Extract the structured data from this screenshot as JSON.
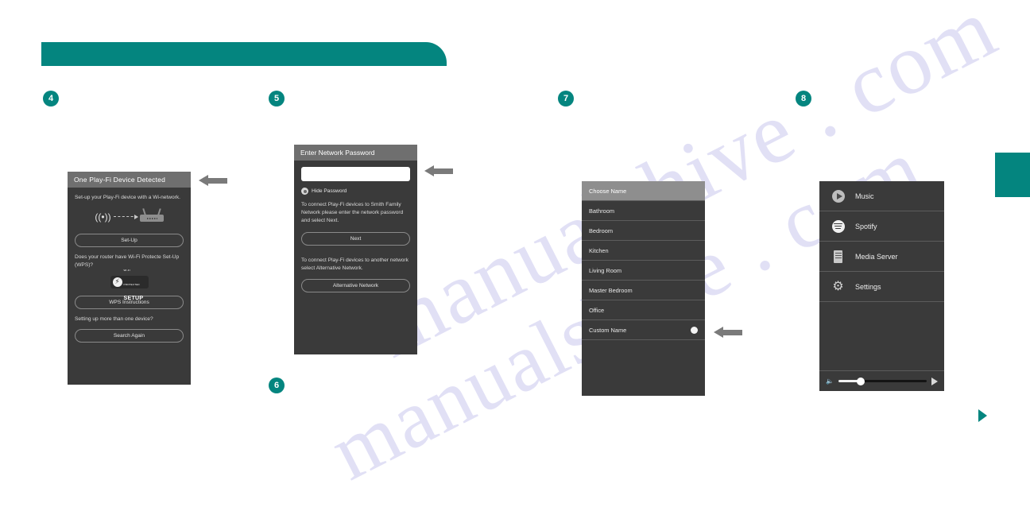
{
  "page": {
    "watermark_line1": "manualshive . com",
    "watermark_line2": "manualshive . com"
  },
  "header": {
    "bar_color": "#04857f",
    "side_tab_color": "#04857f",
    "corner_marker": "play-triangle"
  },
  "steps": [
    {
      "number": "4"
    },
    {
      "number": "5"
    },
    {
      "number": "6"
    },
    {
      "number": "7"
    },
    {
      "number": "8"
    }
  ],
  "panel4": {
    "title": "One Play-Fi Device Detected",
    "intro": "Set-up your Play-Fi device with a Wi-network.",
    "setup_button": "Set-Up",
    "wps_question": "Does your router have Wi-Fi Protecte Set-Up (WPS)?",
    "wps_logo_top": "WI-FI PROTECTED",
    "wps_logo_main": "SETUP",
    "wps_button": "WPS Instructions",
    "more_devices_question": "Setting up more than one device?",
    "search_button": "Search Again"
  },
  "panel5": {
    "title": "Enter Network Password",
    "password_value": "",
    "password_placeholder": "",
    "hide_password_label": "Hide Password",
    "instruction": "To connect Play-Fi devices to Smith Family Network please enter the network password and select Next.",
    "next_button": "Next",
    "alt_instruction": "To connect Play-Fi devices to another network select Alternative Network.",
    "alt_button": "Alternative Network"
  },
  "panel7": {
    "header": "Choose Name",
    "rows": [
      {
        "label": "Bathroom",
        "knob": false
      },
      {
        "label": "Bedroom",
        "knob": false
      },
      {
        "label": "Kitchen",
        "knob": false
      },
      {
        "label": "Living Room",
        "knob": false
      },
      {
        "label": "Master Bedroom",
        "knob": false
      },
      {
        "label": "Office",
        "knob": false
      },
      {
        "label": "Custom Name",
        "knob": true
      }
    ]
  },
  "panel8": {
    "rows": [
      {
        "label": "Music",
        "icon": "play-circle-icon"
      },
      {
        "label": "Spotify",
        "icon": "spotify-icon"
      },
      {
        "label": "Media Server",
        "icon": "server-icon"
      },
      {
        "label": "Settings",
        "icon": "gear-icon"
      }
    ],
    "volume": {
      "mute_icon": "speaker-mute-icon",
      "level": "25",
      "next_icon": "play-next-icon"
    }
  },
  "arrows": [
    {
      "name": "arrow-to-panel-4"
    },
    {
      "name": "arrow-to-panel-5"
    },
    {
      "name": "arrow-to-panel-7"
    }
  ]
}
